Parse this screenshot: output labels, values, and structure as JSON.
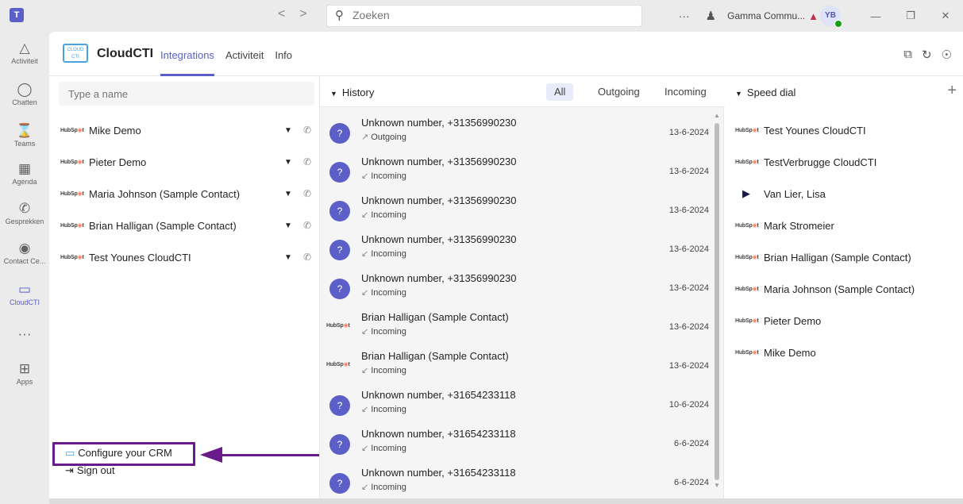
{
  "titlebar": {
    "search_placeholder": "Zoeken",
    "nav_back": "<",
    "nav_forward": ">",
    "org_name": "Gamma Commu...",
    "avatar_initials": "YB",
    "more": "···"
  },
  "rail": {
    "items": [
      {
        "label": "Activiteit",
        "icon": "bell-icon"
      },
      {
        "label": "Chatten",
        "icon": "chat-icon"
      },
      {
        "label": "Teams",
        "icon": "teams-icon"
      },
      {
        "label": "Agenda",
        "icon": "calendar-icon"
      },
      {
        "label": "Gesprekken",
        "icon": "phone-icon"
      },
      {
        "label": "Contact Ce...",
        "icon": "contact-center-icon"
      },
      {
        "label": "CloudCTI",
        "icon": "cloudcti-icon"
      },
      {
        "label": "···",
        "icon": "more-icon"
      },
      {
        "label": "Apps",
        "icon": "apps-icon"
      }
    ]
  },
  "app": {
    "logo_text": "CLOUD CTI",
    "name": "CloudCTI",
    "tabs": [
      "Integrations",
      "Activiteit",
      "Info"
    ]
  },
  "left": {
    "search_placeholder": "Type a name",
    "crm_logo": "HubSpot",
    "contacts": [
      "Mike Demo",
      "Pieter Demo",
      "Maria Johnson (Sample Contact)",
      "Brian Halligan (Sample Contact)",
      "Test Younes CloudCTI"
    ],
    "configure_label": "Configure your CRM",
    "signout_label": "Sign out"
  },
  "history": {
    "title": "History",
    "filters": [
      "All",
      "Outgoing",
      "Incoming"
    ],
    "rows": [
      {
        "name": "Unknown number, +31356990230",
        "direction": "Outgoing",
        "date": "13-6-2024",
        "avatar": "?",
        "crm": false
      },
      {
        "name": "Unknown number, +31356990230",
        "direction": "Incoming",
        "date": "13-6-2024",
        "avatar": "?",
        "crm": false
      },
      {
        "name": "Unknown number, +31356990230",
        "direction": "Incoming",
        "date": "13-6-2024",
        "avatar": "?",
        "crm": false
      },
      {
        "name": "Unknown number, +31356990230",
        "direction": "Incoming",
        "date": "13-6-2024",
        "avatar": "?",
        "crm": false
      },
      {
        "name": "Unknown number, +31356990230",
        "direction": "Incoming",
        "date": "13-6-2024",
        "avatar": "?",
        "crm": false
      },
      {
        "name": "Brian Halligan (Sample Contact)",
        "direction": "Incoming",
        "date": "13-6-2024",
        "avatar": "HubSpot",
        "crm": true
      },
      {
        "name": "Brian Halligan (Sample Contact)",
        "direction": "Incoming",
        "date": "13-6-2024",
        "avatar": "HubSpot",
        "crm": true
      },
      {
        "name": "Unknown number, +31654233118",
        "direction": "Incoming",
        "date": "10-6-2024",
        "avatar": "?",
        "crm": false
      },
      {
        "name": "Unknown number, +31654233118",
        "direction": "Incoming",
        "date": "6-6-2024",
        "avatar": "?",
        "crm": false
      },
      {
        "name": "Unknown number, +31654233118",
        "direction": "Incoming",
        "date": "6-6-2024",
        "avatar": "?",
        "crm": false
      }
    ]
  },
  "speed_dial": {
    "title": "Speed dial",
    "items": [
      {
        "name": "Test Younes CloudCTI",
        "crm": "HubSpot"
      },
      {
        "name": "TestVerbrugge CloudCTI",
        "crm": "HubSpot"
      },
      {
        "name": "Van Lier, Lisa",
        "crm": "dynamics"
      },
      {
        "name": "Mark Stromeier",
        "crm": "HubSpot"
      },
      {
        "name": "Brian Halligan (Sample Contact)",
        "crm": "HubSpot"
      },
      {
        "name": "Maria Johnson (Sample Contact)",
        "crm": "HubSpot"
      },
      {
        "name": "Pieter Demo",
        "crm": "HubSpot"
      },
      {
        "name": "Mike Demo",
        "crm": "HubSpot"
      }
    ]
  },
  "colors": {
    "accent": "#5b5fc7",
    "annotation": "#6a1b8a",
    "hubspot_orange": "#ff7a59"
  }
}
